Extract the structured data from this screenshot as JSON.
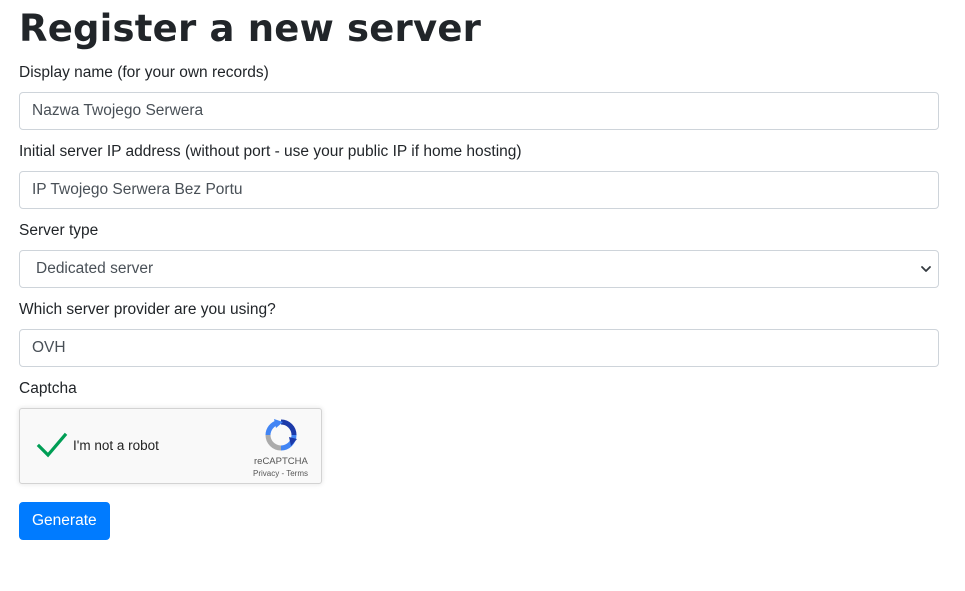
{
  "page": {
    "title": "Register a new server"
  },
  "form": {
    "display_name": {
      "label": "Display name (for your own records)",
      "value": "Nazwa Twojego Serwera"
    },
    "ip_address": {
      "label": "Initial server IP address (without port - use your public IP if home hosting)",
      "value": "IP Twojego Serwera Bez Portu"
    },
    "server_type": {
      "label": "Server type",
      "selected": "Dedicated server"
    },
    "provider": {
      "label": "Which server provider are you using?",
      "value": "OVH"
    },
    "captcha": {
      "label": "Captcha",
      "checkbox_label": "I'm not a robot",
      "checked": true,
      "brand": "reCAPTCHA",
      "privacy": "Privacy",
      "separator": " - ",
      "terms": "Terms"
    },
    "submit_label": "Generate"
  },
  "colors": {
    "primary": "#007bff",
    "check": "#009e55",
    "text": "#212529",
    "border": "#ced4da"
  },
  "icons": {
    "select": "chevron-down-icon",
    "captcha_check": "checkmark-icon",
    "captcha_logo": "recaptcha-logo-icon"
  }
}
